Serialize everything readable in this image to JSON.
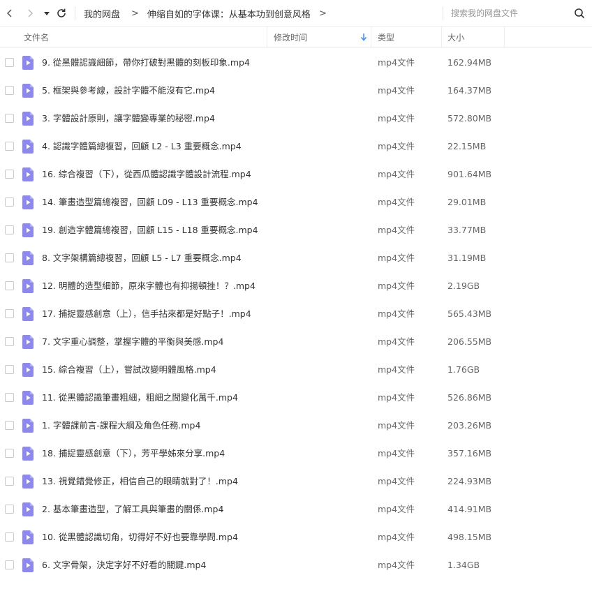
{
  "nav": {
    "back_icon": "chevron-left-icon",
    "forward_icon": "chevron-right-icon",
    "history_icon": "caret-down-icon",
    "refresh_icon": "refresh-icon"
  },
  "breadcrumb": {
    "root": "我的网盘",
    "separator": ">",
    "current": "伸缩自如的字体课：从基本功到创意风格"
  },
  "search": {
    "placeholder": "搜索我的网盘文件",
    "icon": "search-icon"
  },
  "columns": {
    "name": "文件名",
    "modified": "修改时间",
    "type": "类型",
    "size": "大小"
  },
  "colors": {
    "video_icon": "#8c88f0",
    "text": "#333333",
    "muted": "#666666",
    "sort_arrow": "#3b8cf5"
  },
  "files": [
    {
      "name": "9. 從黑體認識細節，帶你打破對黑體的刻板印象.mp4",
      "type": "mp4文件",
      "size": "162.94MB"
    },
    {
      "name": "5. 框架與參考線，設計字體不能沒有它.mp4",
      "type": "mp4文件",
      "size": "164.37MB"
    },
    {
      "name": "3. 字體設計原則，讓字體變專業的秘密.mp4",
      "type": "mp4文件",
      "size": "572.80MB"
    },
    {
      "name": "4. 認識字體篇總複習，回顧 L2 - L3 重要概念.mp4",
      "type": "mp4文件",
      "size": "22.15MB"
    },
    {
      "name": "16. 綜合複習（下），從西瓜體認識字體設計流程.mp4",
      "type": "mp4文件",
      "size": "901.64MB"
    },
    {
      "name": "14. 筆畫造型篇總複習，回顧 L09 - L13 重要概念.mp4",
      "type": "mp4文件",
      "size": "29.01MB"
    },
    {
      "name": "19. 創造字體篇總複習，回顧 L15 - L18 重要概念.mp4",
      "type": "mp4文件",
      "size": "33.77MB"
    },
    {
      "name": "8. 文字架構篇總複習，回顧 L5 - L7 重要概念.mp4",
      "type": "mp4文件",
      "size": "31.19MB"
    },
    {
      "name": "12. 明體的造型細節，原來字體也有抑揚頓挫！？.mp4",
      "type": "mp4文件",
      "size": "2.19GB"
    },
    {
      "name": "17. 捕捉靈感創意（上），信手拈來都是好點子！.mp4",
      "type": "mp4文件",
      "size": "565.43MB"
    },
    {
      "name": "7. 文字重心調整，掌握字體的平衡與美感.mp4",
      "type": "mp4文件",
      "size": "206.55MB"
    },
    {
      "name": "15. 綜合複習（上），嘗試改變明體風格.mp4",
      "type": "mp4文件",
      "size": "1.76GB"
    },
    {
      "name": "11. 從黑體認識筆畫粗細，粗細之間變化萬千.mp4",
      "type": "mp4文件",
      "size": "526.86MB"
    },
    {
      "name": "1. 字體課前言-課程大綱及角色任務.mp4",
      "type": "mp4文件",
      "size": "203.26MB"
    },
    {
      "name": "18. 捕捉靈感創意（下），芳平學姊來分享.mp4",
      "type": "mp4文件",
      "size": "357.16MB"
    },
    {
      "name": "13. 視覺錯覺修正，相信自己的眼睛就對了！.mp4",
      "type": "mp4文件",
      "size": "224.93MB"
    },
    {
      "name": "2. 基本筆畫造型，了解工具與筆畫的關係.mp4",
      "type": "mp4文件",
      "size": "414.91MB"
    },
    {
      "name": "10. 從黑體認識切角，切得好不好也要靠學問.mp4",
      "type": "mp4文件",
      "size": "498.15MB"
    },
    {
      "name": "6. 文字骨架，決定字好不好看的關鍵.mp4",
      "type": "mp4文件",
      "size": "1.34GB"
    }
  ]
}
